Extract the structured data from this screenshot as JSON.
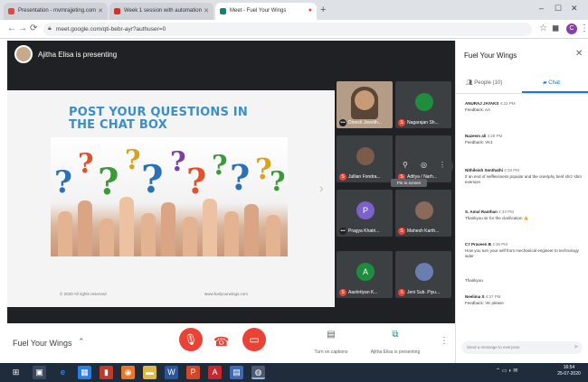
{
  "browser": {
    "tabs": [
      {
        "label": "Presentation - mvmrajjeting.com"
      },
      {
        "label": "Week 1 session with automation"
      },
      {
        "label": "Meet - Fuel Your Wings"
      }
    ],
    "url": "meet.google.com/qti-bebr-ayr?authuser=0",
    "profile_initial": "C",
    "new_tab": "+"
  },
  "meeting": {
    "presenter_banner": "Ajitha Elisa is presenting",
    "name": "Fuel Your Wings",
    "controls": {
      "captions_label": "Turn on captions",
      "presenting_label": "Ajitha Elisa is presenting"
    }
  },
  "slide": {
    "title_line1": "POST YOUR QUESTIONS IN",
    "title_line2": "THE CHAT BOX",
    "footer_left": "© 2020 All rights reserved",
    "footer_right": "www.fuelyourwings.com"
  },
  "participants": [
    {
      "name": "Dinesh Jeevith...",
      "initial": "",
      "color": "#6b5a4e"
    },
    {
      "name": "Nagarajan Sh...",
      "initial": "",
      "color": "#1e8e3e"
    },
    {
      "name": "Jullian Fondra...",
      "initial": "",
      "color": "#7a5c48"
    },
    {
      "name": "Aditya / Narh...",
      "initial": "",
      "color": "#3c4043"
    },
    {
      "name": "Pragya Khatri...",
      "initial": "P",
      "color": "#7b61c9"
    },
    {
      "name": "Mahesh Karth...",
      "initial": "",
      "color": "#8a6a58"
    },
    {
      "name": "Aashrtiyan K...",
      "initial": "A",
      "color": "#1e8e3e"
    },
    {
      "name": "Jeni Sub. Piyu...",
      "initial": "",
      "color": "#6a7fb0"
    }
  ],
  "pin_tooltip": "Pin to screen",
  "panel": {
    "title": "Fuel Your Wings",
    "tab_people": "People (10)",
    "tab_chat": "Chat",
    "messages": [
      {
        "sender": "ANURAJ JAYAKS",
        "time": "4:22 PM",
        "text": "Feedback: AA"
      },
      {
        "sender": "Nazeem ali",
        "time": "4:28 PM",
        "text": "Feedback: VK1"
      },
      {
        "sender": "Nithileish Senthathi",
        "time": "4:33 PM",
        "text": "If an end of selflessness popular and the oneriphy benf shrz sbm exersion"
      },
      {
        "sender": "S. Amul Ranthan",
        "time": "4:33 PM",
        "text": "Thankyou sir for the clarification 👍"
      },
      {
        "sender": "C7 Praveen B",
        "time": "4:36 PM",
        "text": "How you turn your self from mechanical engineer to technology sider"
      },
      {
        "sender": "",
        "time": "",
        "text": "Thankyou"
      },
      {
        "sender": "Neelima S",
        "time": "4:37 PM",
        "text": "Feedback: VK please"
      }
    ],
    "input_placeholder": "Send a message to everyone"
  },
  "taskbar": {
    "clock_time": "16:54",
    "clock_date": "25-07-2020"
  },
  "colors": {
    "meet_dark": "#202124",
    "accent_blue": "#1a73e8",
    "danger_red": "#ea4335",
    "slide_title": "#3a8fc7"
  }
}
